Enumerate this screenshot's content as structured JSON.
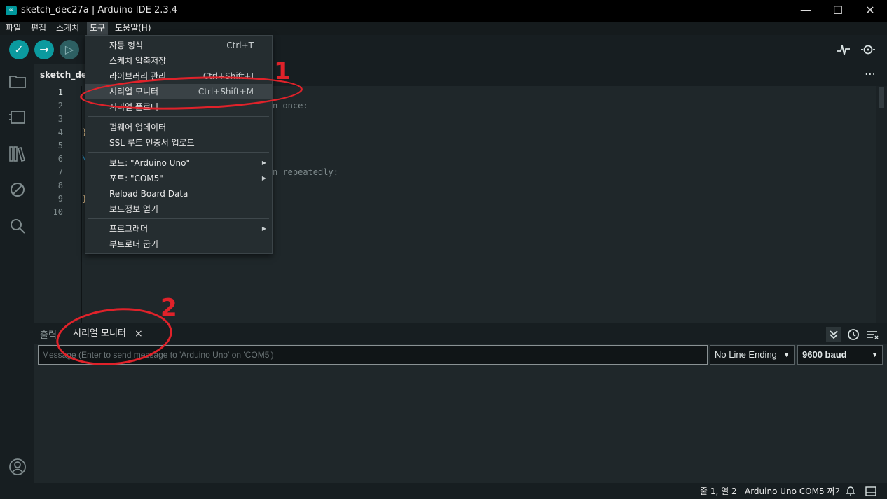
{
  "window": {
    "title": "sketch_dec27a | Arduino IDE 2.3.4",
    "app_icon": "∞",
    "controls": {
      "minimize": "—",
      "maximize": "☐",
      "close": "✕"
    }
  },
  "menubar": {
    "file": "파일",
    "edit": "편집",
    "sketch": "스케치",
    "tools": "도구",
    "help": "도움말(H)"
  },
  "toolbar": {
    "verify": "✓",
    "upload": "→",
    "debug": "▷",
    "plotter_icon": "plotter-icon",
    "monitor_icon": "serial-monitor-icon"
  },
  "editor": {
    "tab_label": "sketch_dec27a",
    "more": "⋯",
    "line_numbers": [
      "1",
      "2",
      "3",
      "4",
      "5",
      "6",
      "7",
      "8",
      "9",
      "10"
    ],
    "visible_code": {
      "l2": "n once:",
      "l7": "n repeatedly:",
      "l4_brace": "}",
      "l6_fragment": "\\",
      "l9_brace": "}"
    }
  },
  "tools_menu": {
    "items": [
      {
        "label": "자동 형식",
        "shortcut": "Ctrl+T"
      },
      {
        "label": "스케치 압축저장",
        "shortcut": ""
      },
      {
        "label": "라이브러리 관리...",
        "shortcut": "Ctrl+Shift+I"
      },
      {
        "label": "시리얼 모니터",
        "shortcut": "Ctrl+Shift+M"
      },
      {
        "label": "시리얼 플로터",
        "shortcut": ""
      },
      {
        "label": "펌웨어 업데이터",
        "shortcut": ""
      },
      {
        "label": "SSL 루트 인증서 업로드",
        "shortcut": ""
      },
      {
        "label": "보드: \"Arduino Uno\"",
        "shortcut": ""
      },
      {
        "label": "포트: \"COM5\"",
        "shortcut": ""
      },
      {
        "label": "Reload Board Data",
        "shortcut": ""
      },
      {
        "label": "보드정보 얻기",
        "shortcut": ""
      },
      {
        "label": "프로그래머",
        "shortcut": ""
      },
      {
        "label": "부트로더 굽기",
        "shortcut": ""
      }
    ],
    "submenu_arrow": "▶"
  },
  "annotations": {
    "one": "1",
    "two": "2"
  },
  "panel": {
    "tab_output": "출력",
    "tab_serial": "시리얼 모니터",
    "close": "×",
    "message_placeholder": "Message (Enter to send message to 'Arduino Uno' on 'COM5')",
    "line_ending": "No Line Ending",
    "baud": "9600 baud",
    "caret": "▼",
    "icons": {
      "autoscroll": "⏬",
      "timestamp": "⏲",
      "clear": "≡"
    }
  },
  "statusbar": {
    "position": "줄 1, 열 2",
    "board": "Arduino Uno COM5 꺼기",
    "bell": "🔔",
    "panel_toggle": "▭"
  },
  "sidebar_icons": {
    "sketchbook": "🗀",
    "boards": "▤",
    "library": "▥",
    "debug": "⊘",
    "search": "⌕",
    "account": "◯"
  }
}
